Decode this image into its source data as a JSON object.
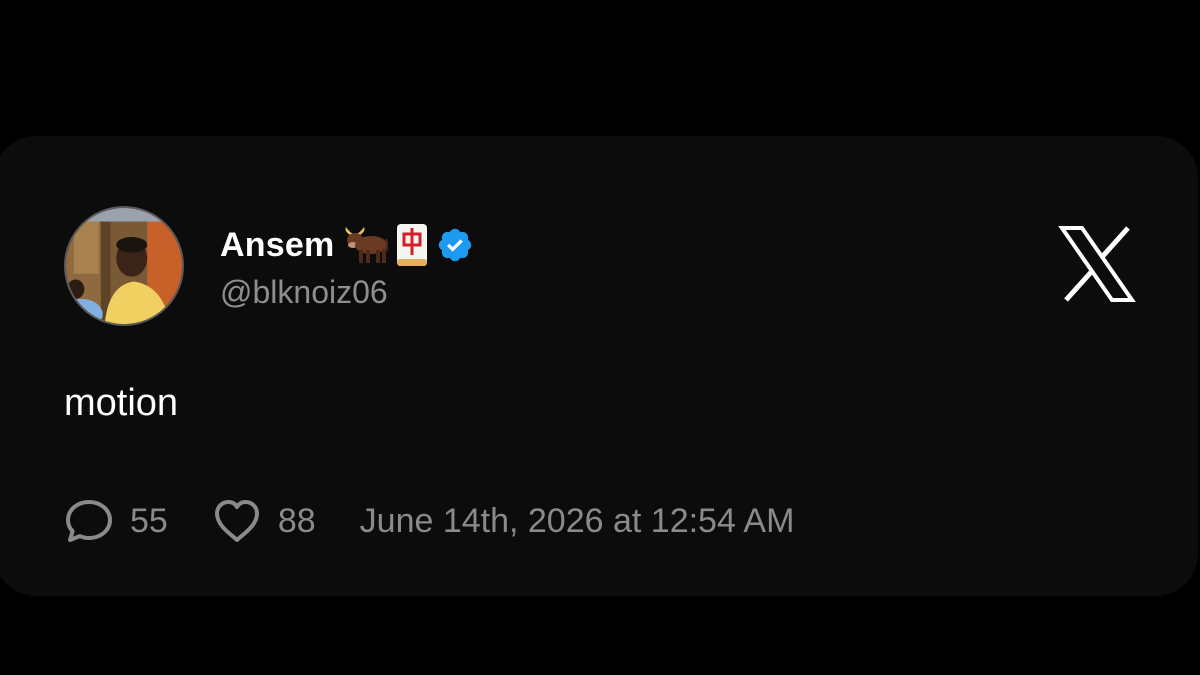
{
  "author": {
    "display_name": "Ansem",
    "name_emojis": [
      "bull-emoji",
      "mahjong-red-dragon-emoji"
    ],
    "verified": true,
    "handle": "@blknoiz06"
  },
  "tweet": {
    "text": "motion"
  },
  "stats": {
    "replies": "55",
    "likes": "88",
    "timestamp": "June 14th, 2026 at 12:54 AM"
  },
  "icons": {
    "platform": "x-logo-icon",
    "reply": "speech-bubble-icon",
    "like": "heart-icon",
    "verified": "verified-check-badge-icon"
  },
  "colors": {
    "background": "#000000",
    "card": "#0c0c0c",
    "primary_text": "#ffffff",
    "secondary_text": "#8e8e8e",
    "verified_blue": "#1d9bf0"
  }
}
